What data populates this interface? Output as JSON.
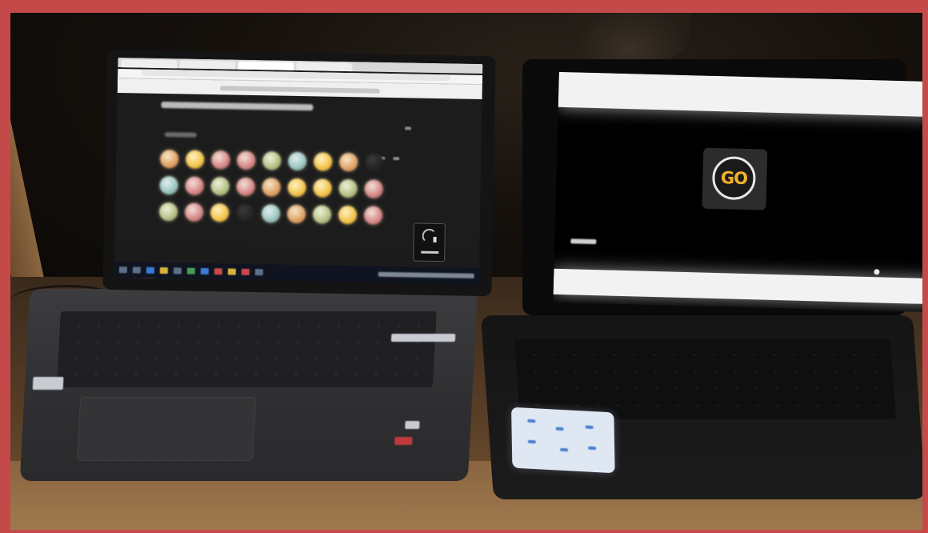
{
  "photo": {
    "left_laptop": {
      "screen": {
        "question_text": "",
        "coin_rows": [
          [
            "c1",
            "c2",
            "c3",
            "c3",
            "c4",
            "c5",
            "c2",
            "c1",
            "dark"
          ],
          [
            "c5",
            "c3",
            "c4",
            "c3",
            "c1",
            "c2",
            "c2",
            "c4",
            "c3"
          ],
          [
            "c4",
            "c3",
            "c2",
            "dark",
            "c5",
            "c1",
            "c4",
            "c2",
            "c3"
          ]
        ],
        "side_card_icon": "gauge-icon"
      }
    },
    "right_laptop": {
      "screen": {
        "go_label": "GO",
        "go_color": "#f3b22b"
      }
    },
    "frame_color": "#c44a4a"
  }
}
